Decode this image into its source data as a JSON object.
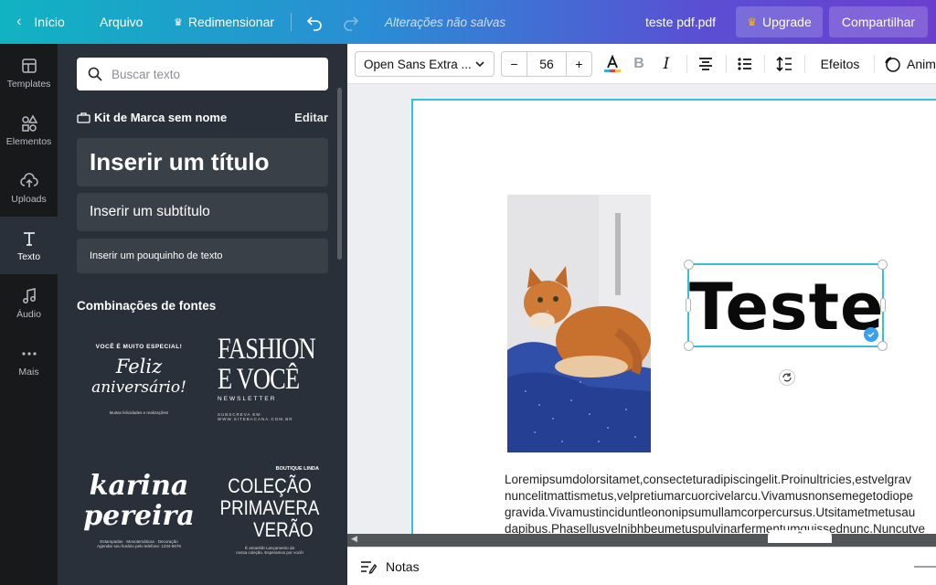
{
  "topbar": {
    "home_label": "Início",
    "file_label": "Arquivo",
    "resize_label": "Redimensionar",
    "unsaved_text": "Alterações não salvas",
    "doc_title": "teste pdf.pdf",
    "upgrade_label": "Upgrade",
    "share_label": "Compartilhar",
    "colors": {
      "gradient_start": "#11b3c2",
      "gradient_end": "#6a3fd0",
      "crown": "#f5b324"
    }
  },
  "rail": {
    "items": [
      {
        "label": "Templates",
        "icon": "templates-icon"
      },
      {
        "label": "Elementos",
        "icon": "elements-icon"
      },
      {
        "label": "Uploads",
        "icon": "upload-cloud-icon"
      },
      {
        "label": "Texto",
        "icon": "text-icon",
        "active": true
      },
      {
        "label": "Áudio",
        "icon": "music-note-icon"
      },
      {
        "label": "Mais",
        "icon": "more-dots-icon"
      }
    ]
  },
  "panel": {
    "search_placeholder": "Buscar texto",
    "brand_kit_label": "Kit de Marca sem nome",
    "edit_label": "Editar",
    "heading_label": "Inserir um título",
    "subheading_label": "Inserir um subtítulo",
    "body_label": "Inserir um pouquinho de texto",
    "font_combos_heading": "Combinações de fontes",
    "combos": [
      {
        "top": "VOCÊ É MUITO ESPECIAL!",
        "main1": "Feliz",
        "main2": "aniversário!",
        "foot": "Muitas felicidades e realizações!"
      },
      {
        "main1": "FASHION",
        "main2": "E VOCÊ",
        "sub": "NEWSLETTER",
        "foot1": "SUBSCREVA EM:",
        "foot2": "WWW.SITEBACANA.COM.BR"
      },
      {
        "main1": "karina",
        "main2": "pereira",
        "foot1": "Estampadas · Monotemáticas · Decoração",
        "foot2": "Agendar seu horário pelo telefone: 1234-5678"
      },
      {
        "top": "BOUTIQUE LINDA",
        "main1": "COLEÇÃO",
        "main2": "PRIMAVERA",
        "main3": "VERÃO",
        "foot1": "É amanhã! Lançamento da",
        "foot2": "nossa coleção. Esperamos por você!"
      }
    ]
  },
  "toolbar": {
    "font_name": "Open Sans Extra ...",
    "font_size": "56",
    "minus": "−",
    "plus": "+",
    "bold": "B",
    "italic": "I",
    "effects_label": "Efeitos",
    "animate_label": "Anim",
    "text_color": "#e8403a"
  },
  "canvas": {
    "heading_text": "Teste",
    "lorem_lines": [
      "Loremipsumdolorsitamet,consecteturadipiscingelit.Proinultricies,estvelgrav",
      "nuncelitmattismetus,velpretiumarcuorcivelarcu.Vivamusnonsemegetodiope",
      "gravida.Vivamustinciduntleononipsumullamcorpercursus.Utsitametmetusau",
      "dapibus.Phasellusvelnibhbeumetuspulvinarfermentumquissednunc.Nuncutve"
    ],
    "selection_color": "#31c2d3"
  },
  "notes": {
    "label": "Notas"
  }
}
